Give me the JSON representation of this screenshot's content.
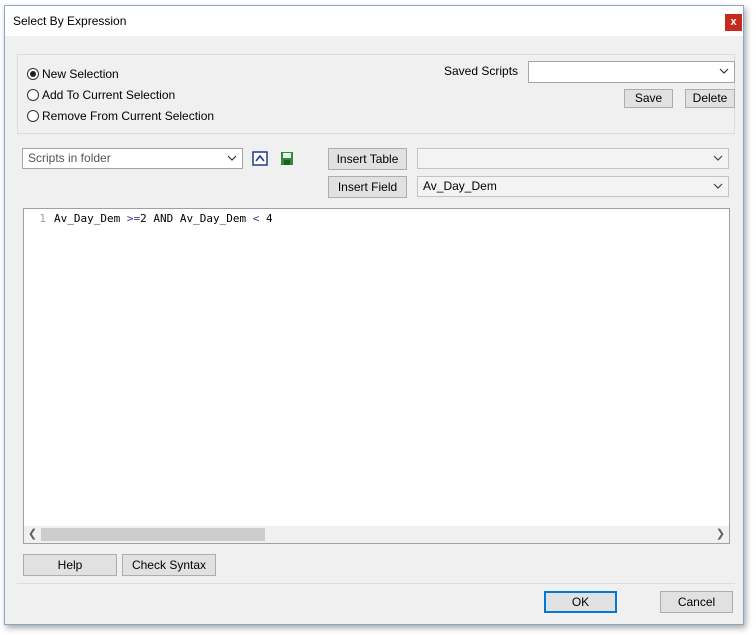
{
  "window": {
    "title": "Select By Expression",
    "close_label": "x"
  },
  "selection_mode": {
    "options": [
      {
        "label": "New Selection",
        "checked": true
      },
      {
        "label": "Add To Current Selection",
        "checked": false
      },
      {
        "label": "Remove From Current Selection",
        "checked": false
      }
    ]
  },
  "saved_scripts": {
    "label": "Saved Scripts",
    "value": "",
    "save_label": "Save",
    "delete_label": "Delete"
  },
  "scripts_folder": {
    "value": "Scripts in folder"
  },
  "insert": {
    "table_label": "Insert Table",
    "table_value": "",
    "field_label": "Insert Field",
    "field_value": "Av_Day_Dem"
  },
  "editor": {
    "line_number": "1",
    "code_field1": "Av_Day_Dem",
    "code_op1": " >=",
    "code_mid": "2 AND Av_Day_Dem ",
    "code_op2": "<",
    "code_end": " 4"
  },
  "bottom": {
    "help_label": "Help",
    "check_syntax_label": "Check Syntax",
    "ok_label": "OK",
    "cancel_label": "Cancel"
  },
  "colors": {
    "accent": "#0078d7",
    "close": "#c42b1c"
  }
}
